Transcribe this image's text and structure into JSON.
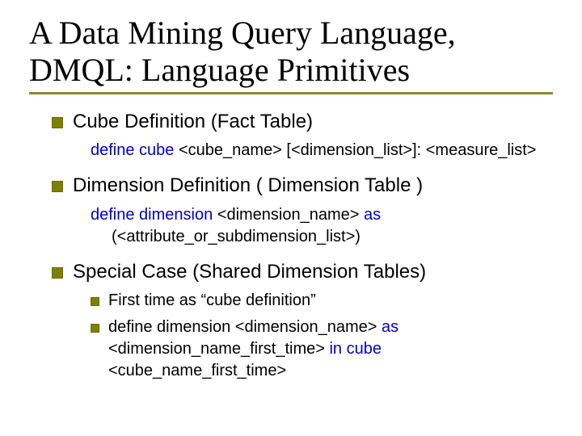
{
  "title": "A Data Mining Query Language, DMQL: Language Primitives",
  "b1": {
    "heading": "Cube Definition (Fact Table)",
    "code_kw1": "define cube",
    "code_rest": " <cube_name> [<dimension_list>]: <measure_list>"
  },
  "b2": {
    "heading": "Dimension Definition ( Dimension Table )",
    "code_kw1": "define dimension",
    "code_mid": " <dimension_name> ",
    "code_kw2": "as",
    "code_rest": " (<attribute_or_subdimension_list>)"
  },
  "b3": {
    "heading": "Special Case (Shared Dimension Tables)",
    "sub1": "First time as “cube definition”",
    "sub2_plain1": "define dimension <dimension_name> ",
    "sub2_kw1": "as",
    "sub2_plain2": " <dimension_name_first_time> ",
    "sub2_kw2": "in cube",
    "sub2_plain3": " <cube_name_first_time>"
  }
}
